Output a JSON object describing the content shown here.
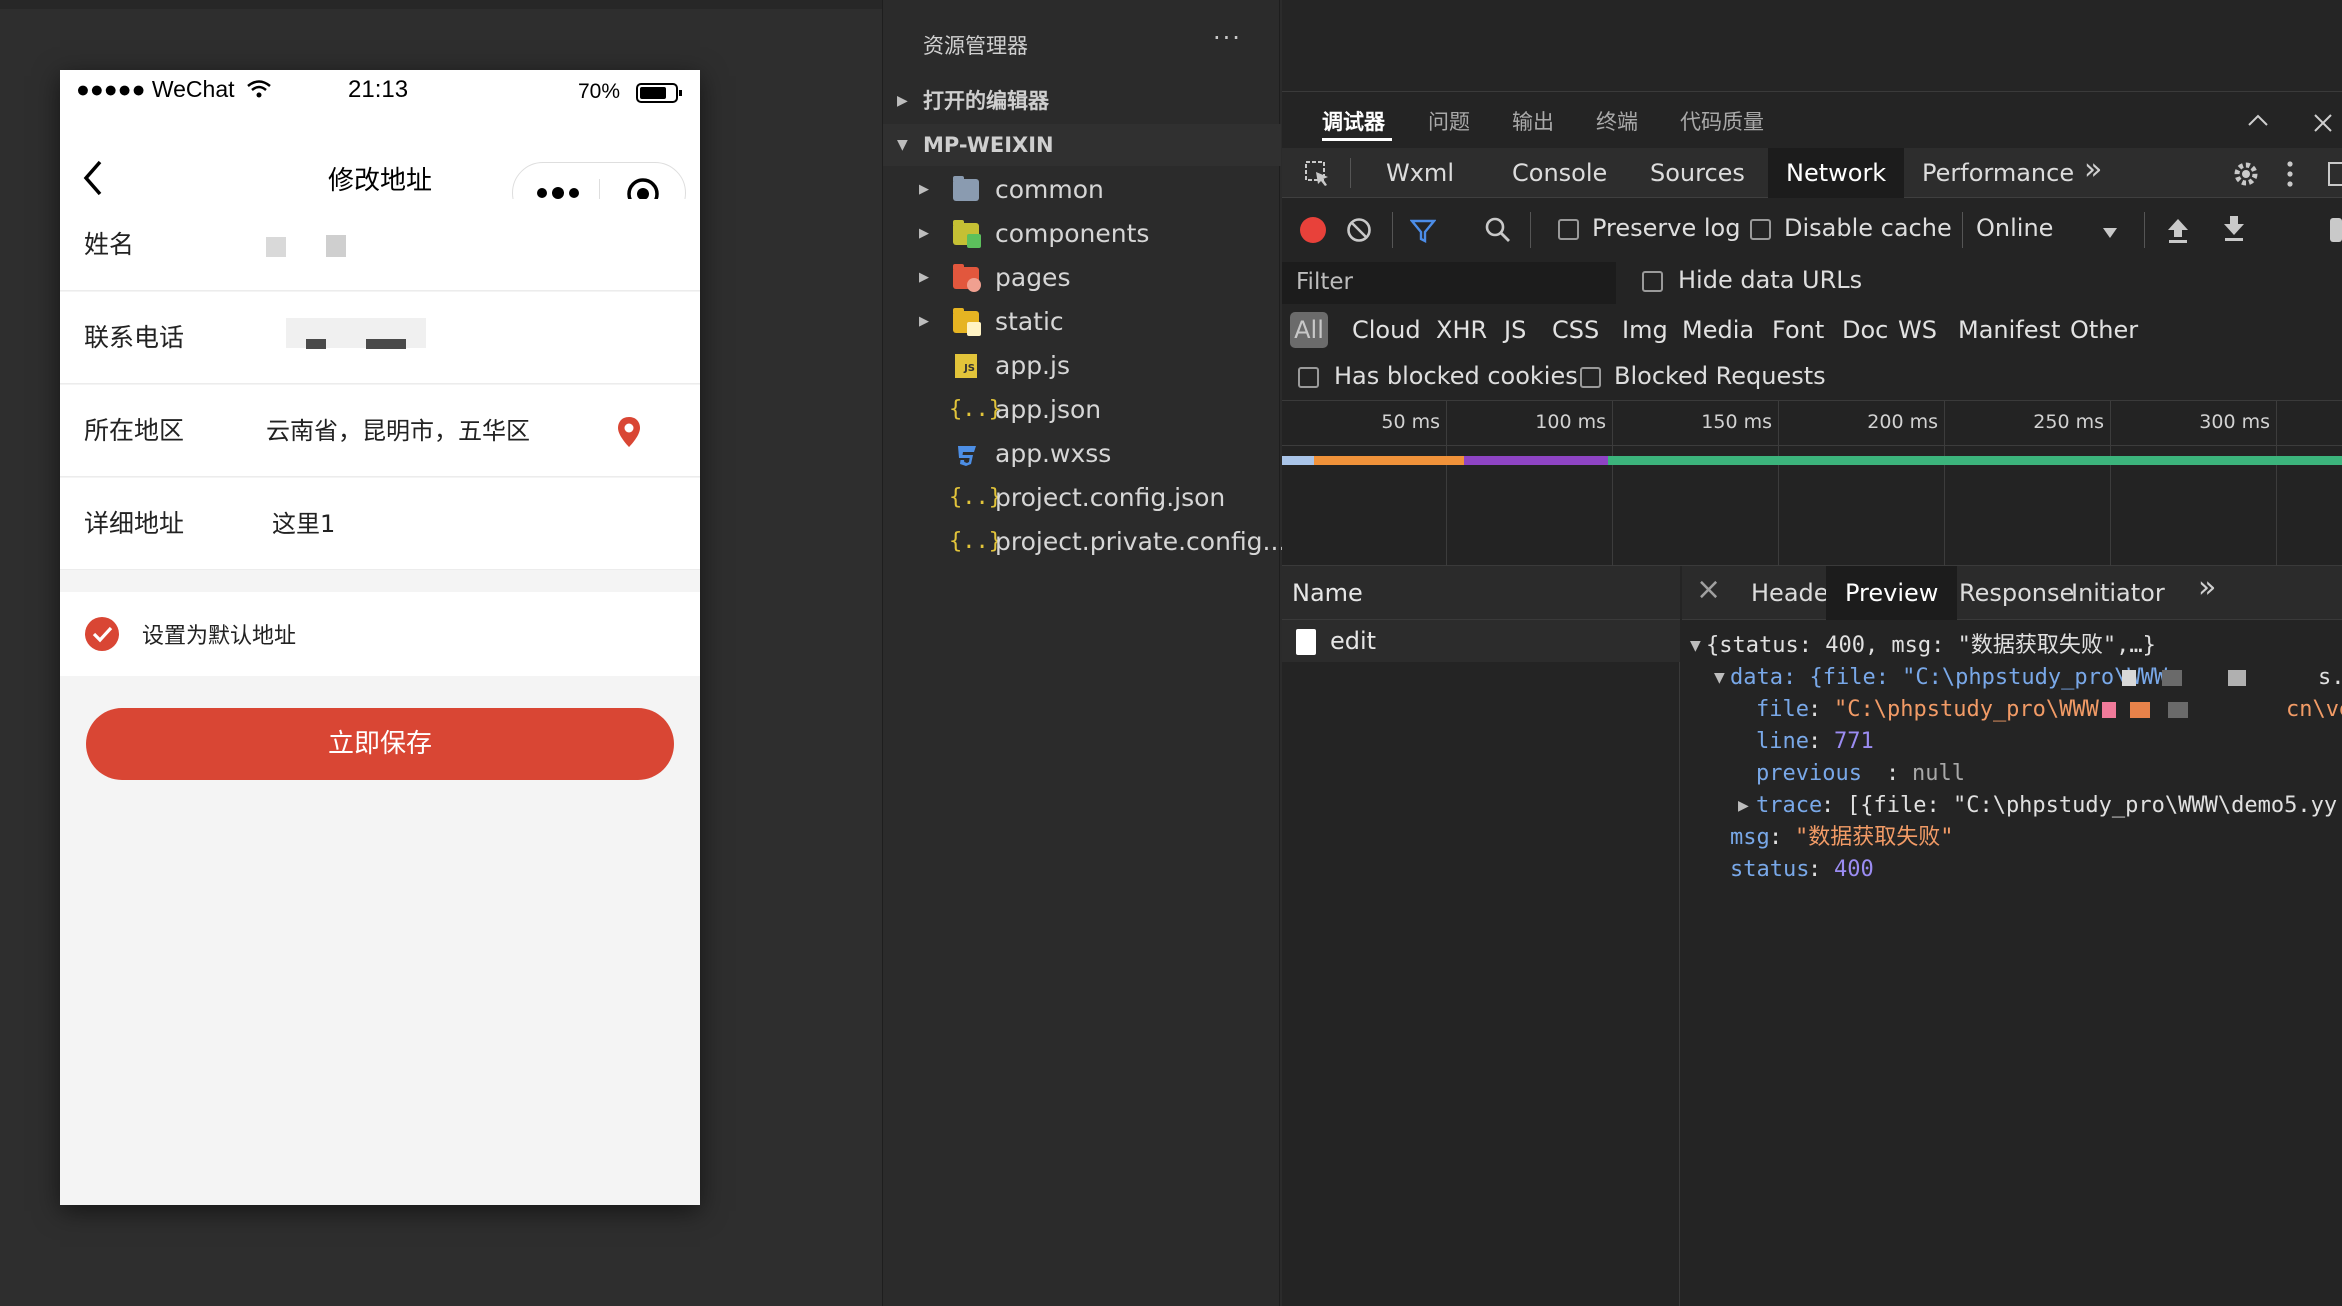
{
  "simulator": {
    "status": {
      "carrier": "●●●●● WeChat",
      "time": "21:13",
      "battery": "70%"
    },
    "nav_title": "修改地址",
    "rows": [
      {
        "label": "姓名",
        "value": ""
      },
      {
        "label": "联系电话",
        "value": ""
      },
      {
        "label": "所在地区",
        "value": "云南省，昆明市，五华区"
      },
      {
        "label": "详细地址",
        "value": "这里1"
      }
    ],
    "default_label": "设置为默认地址",
    "save_label": "立即保存",
    "accent": "#d94634"
  },
  "explorer": {
    "title": "资源管理器",
    "menu_glyph": "···",
    "sections": [
      "打开的编辑器",
      "MP-WEIXIN"
    ],
    "tree": [
      {
        "name": "common",
        "icon": "folder-icon"
      },
      {
        "name": "components",
        "icon": "components-folder-icon"
      },
      {
        "name": "pages",
        "icon": "pages-folder-icon"
      },
      {
        "name": "static",
        "icon": "static-folder-icon"
      },
      {
        "name": "app.js",
        "icon": "js-file-icon"
      },
      {
        "name": "app.json",
        "icon": "json-file-icon"
      },
      {
        "name": "app.wxss",
        "icon": "css-file-icon"
      },
      {
        "name": "project.config.json",
        "icon": "json-file-icon"
      },
      {
        "name": "project.private.config...",
        "icon": "json-file-icon"
      }
    ]
  },
  "devtools": {
    "cn_tabs": [
      "调试器",
      "问题",
      "输出",
      "终端",
      "代码质量"
    ],
    "tabs": [
      "Wxml",
      "Console",
      "Sources",
      "Network",
      "Performance"
    ],
    "more_glyph": "»",
    "active_tab": "Network",
    "toolbar": {
      "preserve_log": "Preserve log",
      "disable_cache": "Disable cache",
      "throttle": "Online"
    },
    "filter": {
      "placeholder": "Filter",
      "hide_data_urls": "Hide data URLs"
    },
    "types": [
      "All",
      "Cloud",
      "XHR",
      "JS",
      "CSS",
      "Img",
      "Media",
      "Font",
      "Doc",
      "WS",
      "Manifest",
      "Other"
    ],
    "blocked": {
      "cookies": "Has blocked cookies",
      "requests": "Blocked Requests"
    },
    "ticks": [
      "50 ms",
      "100 ms",
      "150 ms",
      "200 ms",
      "250 ms",
      "300 ms"
    ],
    "name_header": "Name",
    "request": "edit",
    "close_glyph": "×",
    "detail_tabs": [
      "Headers",
      "Preview",
      "Response",
      "Initiator"
    ],
    "preview": {
      "summary": "{status: 400, msg: \"数据获取失败\",…}",
      "data_prefix": "data: {file: \"C:\\phpstudy_pro\\WWW",
      "data_tail": "s.",
      "file_key": "file",
      "file_val": "\"C:\\phpstudy_pro\\WWW",
      "file_tail": "cn\\ve",
      "line_key": "line",
      "line_val": "771",
      "previous_key": "previous",
      "previous_val": "null",
      "trace_key": "trace",
      "trace_val": "[{file: \"C:\\phpstudy_pro\\WWW\\demo5.yy",
      "msg_key": "msg",
      "msg_val": "\"数据获取失败\"",
      "status_key": "status",
      "status_val": "400"
    }
  }
}
